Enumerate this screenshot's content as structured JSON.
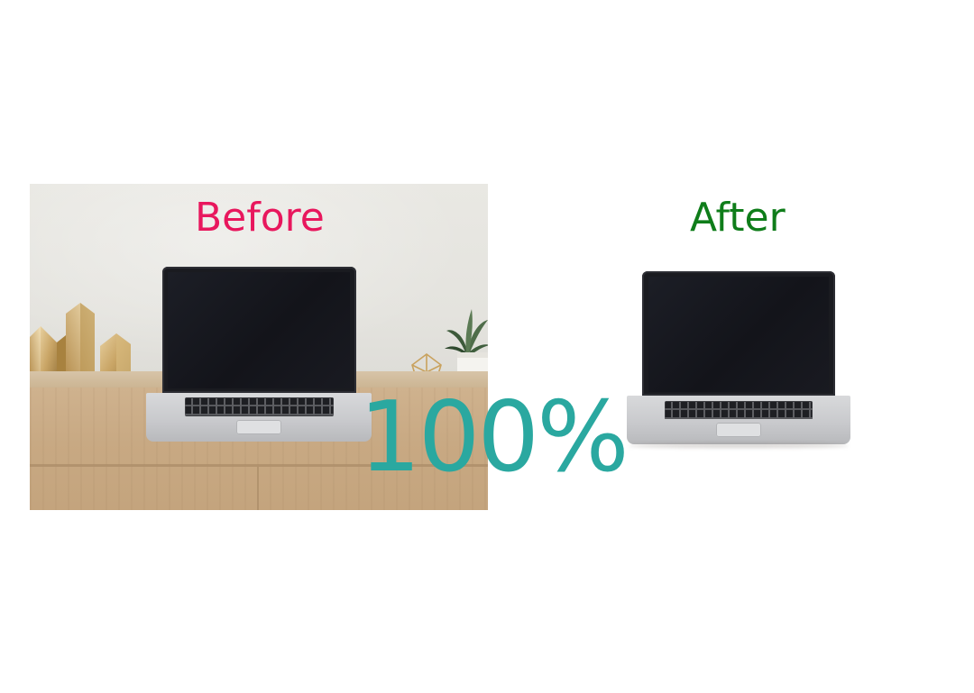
{
  "labels": {
    "before": "Before",
    "after": "After",
    "percent": "100%"
  },
  "colors": {
    "before_label": "#e8175d",
    "after_label": "#0f7d1a",
    "percent_label": "#2aa8a0",
    "background": "#ffffff"
  },
  "images": {
    "before": "laptop-on-wooden-desk-photo",
    "after": "laptop-cutout-white-background"
  }
}
